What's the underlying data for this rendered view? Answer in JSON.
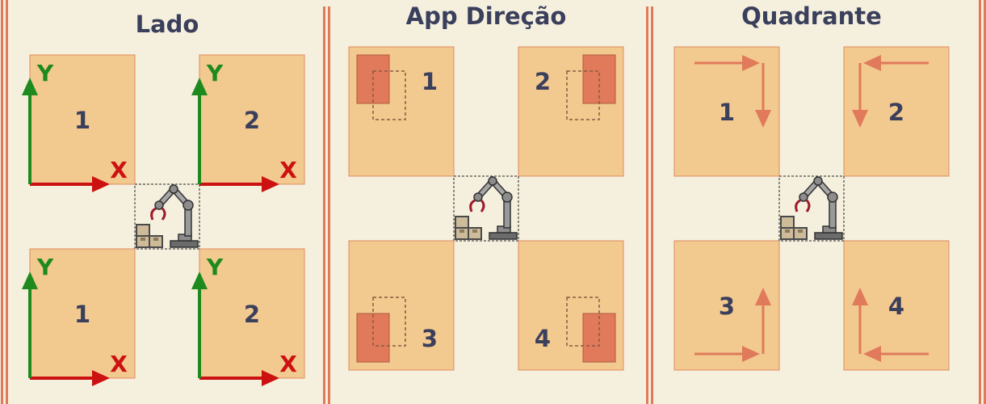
{
  "colors": {
    "background": "#f5f0de",
    "pallet_fill": "#f2c98e",
    "pallet_border": "#e08a63",
    "divider": "#e07a5a",
    "accent_box": "#e07a5a",
    "title_text": "#3a3f5c",
    "axis_x": "#cc1111",
    "axis_y": "#1e8a1e",
    "arrow": "#e07a5a"
  },
  "panels": {
    "lado": {
      "title": "Lado",
      "pallets": [
        {
          "number": "1",
          "x_label": "X",
          "y_label": "Y"
        },
        {
          "number": "2",
          "x_label": "X",
          "y_label": "Y"
        },
        {
          "number": "1",
          "x_label": "X",
          "y_label": "Y"
        },
        {
          "number": "2",
          "x_label": "X",
          "y_label": "Y"
        }
      ]
    },
    "app_direcao": {
      "title": "App Direção",
      "pallets": [
        {
          "number": "1"
        },
        {
          "number": "2"
        },
        {
          "number": "3"
        },
        {
          "number": "4"
        }
      ]
    },
    "quadrante": {
      "title": "Quadrante",
      "pallets": [
        {
          "number": "1"
        },
        {
          "number": "2"
        },
        {
          "number": "3"
        },
        {
          "number": "4"
        }
      ]
    }
  },
  "icons": [
    "robot-arm-icon",
    "boxes-icon",
    "arrow-icon"
  ]
}
